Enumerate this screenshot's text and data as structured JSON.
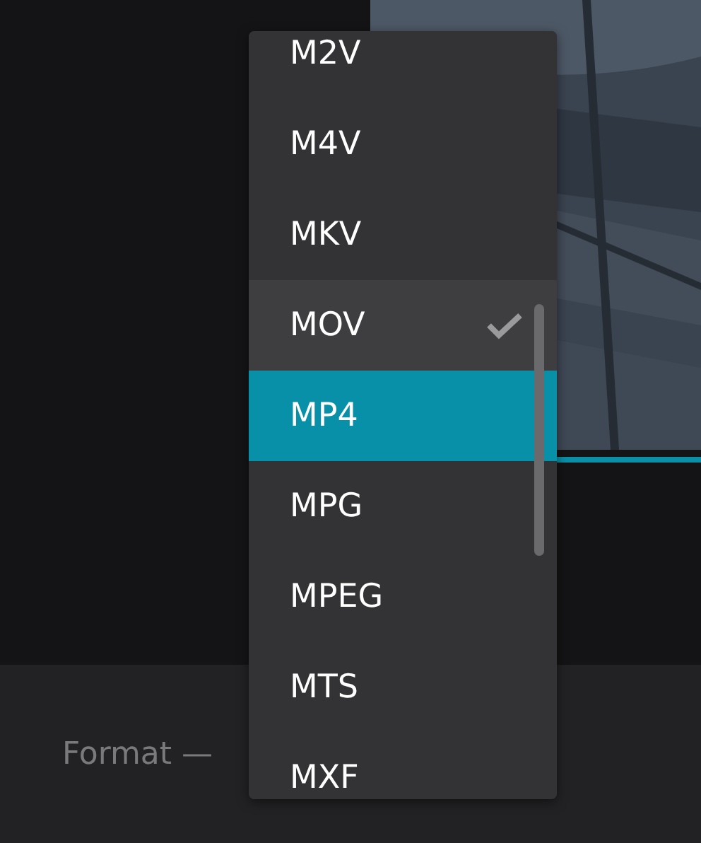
{
  "format_field": {
    "label": "Format —"
  },
  "menu": {
    "items": [
      {
        "label": "M2V",
        "checked": false,
        "highlighted": false
      },
      {
        "label": "M4V",
        "checked": false,
        "highlighted": false
      },
      {
        "label": "MKV",
        "checked": false,
        "highlighted": false
      },
      {
        "label": "MOV",
        "checked": true,
        "highlighted": false
      },
      {
        "label": "MP4",
        "checked": false,
        "highlighted": true
      },
      {
        "label": "MPG",
        "checked": false,
        "highlighted": false
      },
      {
        "label": "MPEG",
        "checked": false,
        "highlighted": false
      },
      {
        "label": "MTS",
        "checked": false,
        "highlighted": false
      },
      {
        "label": "MXF",
        "checked": false,
        "highlighted": false
      }
    ]
  }
}
